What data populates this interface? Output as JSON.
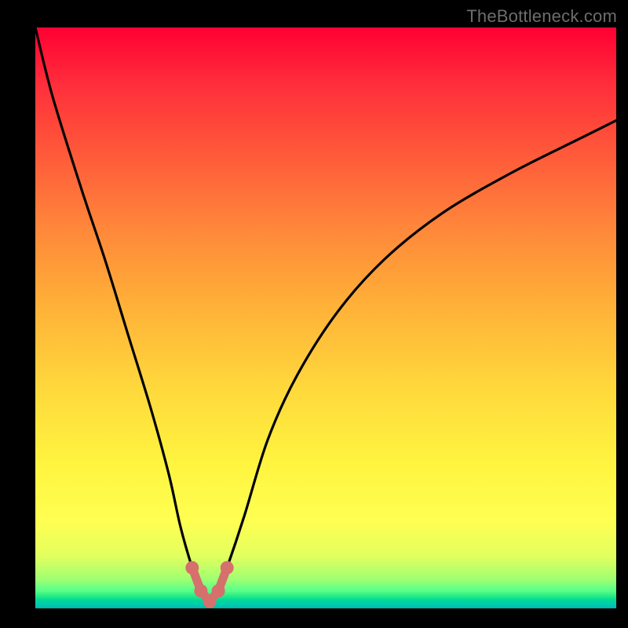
{
  "watermark": "TheBottleneck.com",
  "colors": {
    "frame_bg": "#000000",
    "curve_stroke": "#000000",
    "marker_fill": "#d5706d",
    "marker_stroke": "#d5706d"
  },
  "chart_data": {
    "type": "line",
    "title": "",
    "xlabel": "",
    "ylabel": "",
    "xlim": [
      0,
      100
    ],
    "ylim": [
      0,
      100
    ],
    "grid": false,
    "legend": false,
    "x": [
      0,
      3,
      8,
      12,
      16,
      20,
      23,
      25,
      27,
      28.5,
      30,
      31.5,
      33,
      36,
      40,
      45,
      52,
      60,
      70,
      82,
      94,
      100
    ],
    "series": [
      {
        "name": "bottleneck-curve",
        "values": [
          100,
          88,
          72,
          60,
          47,
          34,
          23,
          14,
          7,
          3,
          1.2,
          3,
          7,
          16,
          29,
          40,
          51,
          60,
          68,
          75,
          81,
          84
        ]
      }
    ],
    "markers": {
      "x": [
        27,
        28.5,
        30,
        31.5,
        33
      ],
      "y": [
        7,
        3,
        1.2,
        3,
        7
      ]
    },
    "background_gradient": {
      "orientation": "vertical",
      "stops": [
        {
          "pos": 0.0,
          "color": "#ff0033"
        },
        {
          "pos": 0.5,
          "color": "#ffb138"
        },
        {
          "pos": 0.8,
          "color": "#ffff52"
        },
        {
          "pos": 0.95,
          "color": "#9fff72"
        },
        {
          "pos": 1.0,
          "color": "#00b4a3"
        }
      ]
    }
  }
}
